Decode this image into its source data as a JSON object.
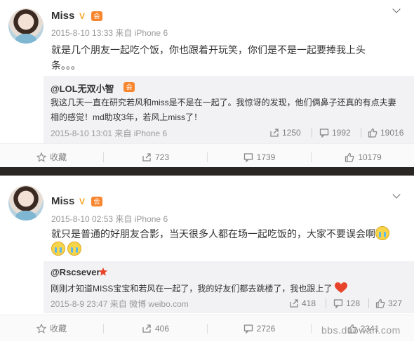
{
  "posts": [
    {
      "author": "Miss",
      "verified_mark": "V",
      "vip_badge": "会员",
      "meta": "2015-8-10 13:33 来自 iPhone 6",
      "text_line1": "就是几个朋友一起吃个饭，你也跟着开玩笑，你们是不是一起要捧我上头",
      "text_line2": "条。。。",
      "repost": {
        "author": "@LOL无双小智",
        "vip_badge": "会员",
        "text_line1": "我这几天一直在研究若风和miss是不是在一起了。我惊讶的发现，他们俩鼻子还真的有点夫妻",
        "text_line2": "相的感觉！md助攻3年，若风上miss了！",
        "meta": "2015-8-10 13:01 来自 iPhone 6",
        "reposts": "1250",
        "comments": "1992",
        "likes": "19016"
      },
      "actions": {
        "favorite": "收藏",
        "reposts": "723",
        "comments": "1739",
        "likes": "10179"
      }
    },
    {
      "author": "Miss",
      "verified_mark": "V",
      "vip_badge": "会员",
      "meta": "2015-8-10 02:53 来自 iPhone 6",
      "text_line1": "就只是普通的好朋友合影，当天很多人都在场一起吃饭的，大家不要误会啊",
      "repost": {
        "author": "@Rscsever",
        "text": "刚刚才知道MISS宝宝和若风在一起了，我的好友们都去跳楼了，我也跟上了",
        "meta": "2015-8-9 23:47 来自 微博 weibo.com",
        "reposts": "418",
        "comments": "128",
        "likes": "327"
      },
      "actions": {
        "favorite": "收藏",
        "reposts": "406",
        "comments": "2726",
        "likes": "2341"
      }
    }
  ],
  "watermark": "bbs.duowan.com",
  "icons": [
    "chevron-down-icon",
    "star-icon",
    "repost-icon",
    "comment-icon",
    "like-icon",
    "crying-emoji-icon",
    "heart-emoji-icon",
    "red-star-icon"
  ],
  "colors": {
    "divider": "#2a2624",
    "repost_bg": "#f2f2f5",
    "meta": "#999999",
    "verified": "#f5a623",
    "vip": "#f7862f"
  }
}
